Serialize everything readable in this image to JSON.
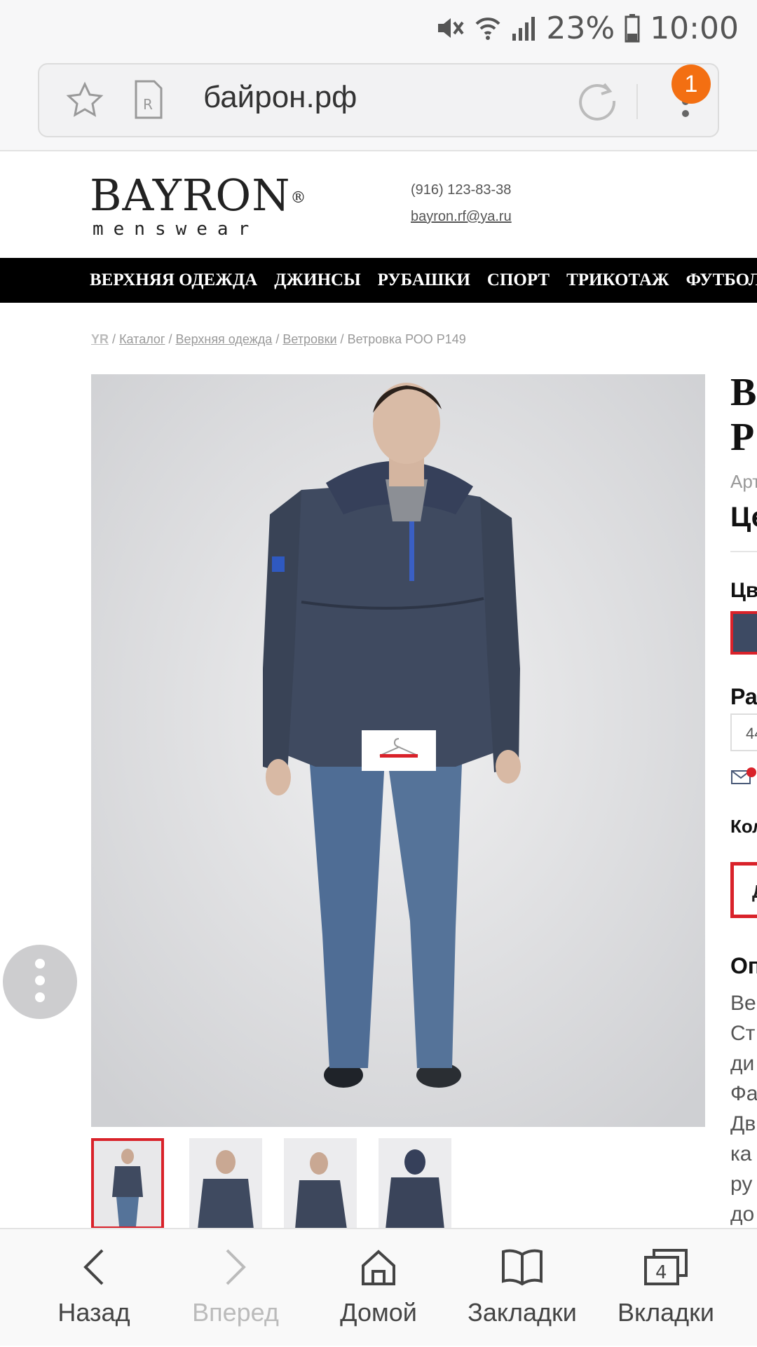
{
  "status_bar": {
    "battery": "23%",
    "time": "10:00",
    "icons": [
      "mute-icon",
      "wifi-icon",
      "signal-icon",
      "battery-icon"
    ]
  },
  "browser": {
    "url": "байрон.рф",
    "notification_count": "1",
    "icons": [
      "bookmark-star-icon",
      "reader-mode-icon",
      "reload-icon",
      "menu-icon"
    ]
  },
  "site": {
    "logo_main": "BAYRON",
    "logo_reg": "®",
    "logo_sub": "menswear",
    "phone": "(916) 123-83-38",
    "email": "bayron.rf@ya.ru"
  },
  "nav": {
    "items": [
      "ВЕРХНЯЯ ОДЕЖДА",
      "ДЖИНСЫ",
      "РУБАШКИ",
      "СПОРТ",
      "ТРИКОТАЖ",
      "ФУТБОЛКИ"
    ]
  },
  "breadcrumb": {
    "home": "YR",
    "sep": "/",
    "items": [
      "Каталог",
      "Верхняя одежда",
      "Ветровки"
    ],
    "current": "Ветровка РОО Р149"
  },
  "product_partial": {
    "title_line1": "В",
    "title_line2": "Р",
    "article": "Арт",
    "price": "Це",
    "color_label": "Цв",
    "size_label": "Ра",
    "size_value": "44",
    "qty_label": "Кол",
    "button": "Д",
    "desc_label": "Оп",
    "desc_lines": [
      "Ве",
      "Ст",
      "ди",
      "Фа",
      "Дв",
      "ка",
      "ру",
      "до"
    ]
  },
  "colors": {
    "accent": "#d9222a",
    "nav_bg": "#000000",
    "badge": "#f36f12"
  },
  "bottom_bar": {
    "back": "Назад",
    "forward": "Вперед",
    "home": "Домой",
    "bookmarks": "Закладки",
    "tabs": "Вкладки",
    "tabs_count": "4"
  }
}
